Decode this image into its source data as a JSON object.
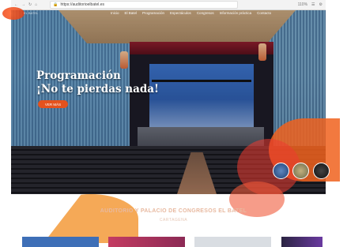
{
  "browser": {
    "url": "https://auditorioelbatel.es",
    "zoom": "110%"
  },
  "header": {
    "logo_text": "EL BATEL",
    "nav_items": [
      "Inicio",
      "El Batel",
      "Programación",
      "Espectáculos",
      "Congresos",
      "Información práctica",
      "Contacto"
    ]
  },
  "hero": {
    "title_line1": "Programación",
    "title_line2": "¡No te pierdas nada!",
    "button_label": "VER MÁS"
  },
  "section": {
    "title": "AUDITORIO Y PALACIO DE CONGRESOS EL BATEL",
    "subtitle": "CARTAGENA"
  },
  "colors": {
    "accent": "#e4521d",
    "orange": "#f39a3a",
    "red": "#ef3b2f"
  }
}
